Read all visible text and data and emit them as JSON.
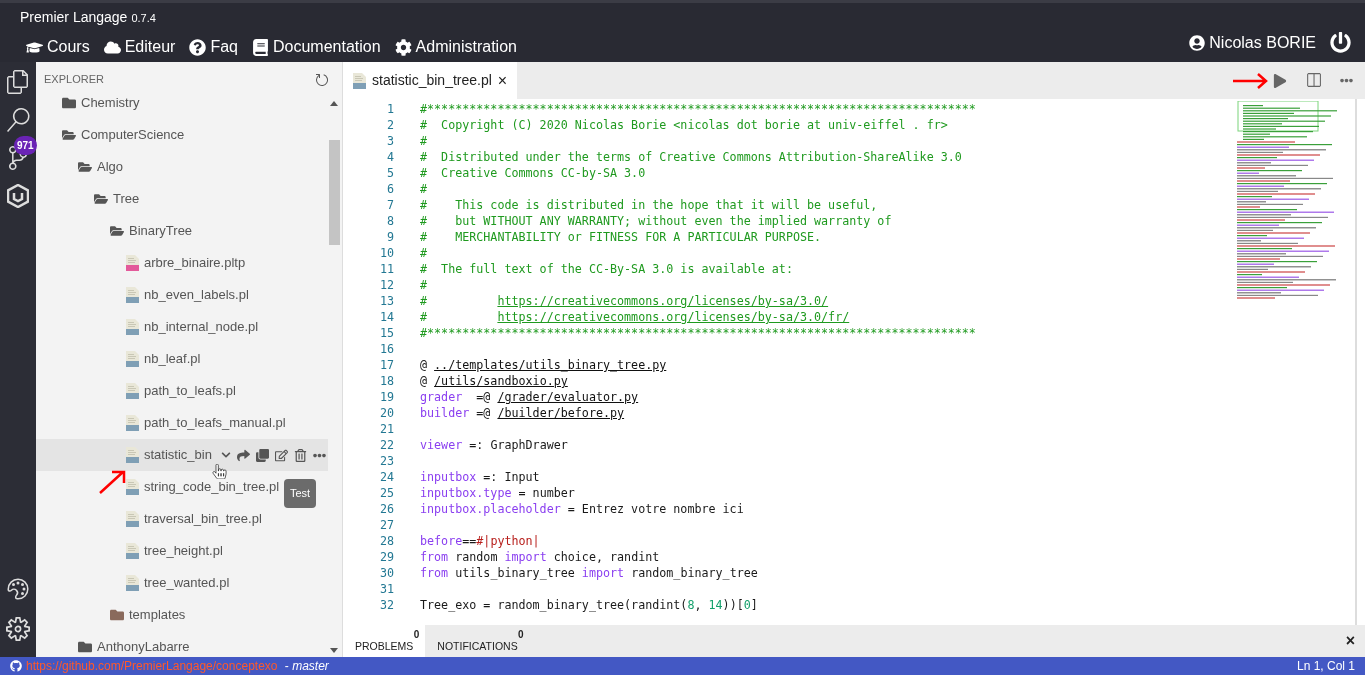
{
  "app": {
    "title": "Premier Langage",
    "version": "0.7.4"
  },
  "nav": [
    {
      "kind": "courses",
      "label": "Cours"
    },
    {
      "kind": "editor",
      "label": "Editeur"
    },
    {
      "kind": "faq",
      "label": "Faq"
    },
    {
      "kind": "docs",
      "label": "Documentation"
    },
    {
      "kind": "admin",
      "label": "Administration"
    }
  ],
  "user": {
    "name": "Nicolas BORIE"
  },
  "activity_bar": {
    "badge": "971"
  },
  "explorer": {
    "title": "EXPLORER",
    "tree": [
      {
        "kind": "folder",
        "label": "Chemistry",
        "expanded": false,
        "hovered": false
      },
      {
        "kind": "folder",
        "label": "ComputerScience",
        "expanded": true,
        "hovered": false,
        "children": [
          {
            "kind": "folder",
            "label": "Algo",
            "expanded": true,
            "hovered": false,
            "children": [
              {
                "kind": "folder",
                "label": "Tree",
                "expanded": true,
                "hovered": false,
                "children": [
                  {
                    "kind": "folder",
                    "label": "BinaryTree",
                    "expanded": true,
                    "hovered": false,
                    "children": [
                      {
                        "kind": "pltp",
                        "label": "arbre_binaire.pltp",
                        "hovered": false
                      },
                      {
                        "kind": "pl",
                        "label": "nb_even_labels.pl",
                        "hovered": false
                      },
                      {
                        "kind": "pl",
                        "label": "nb_internal_node.pl",
                        "hovered": false
                      },
                      {
                        "kind": "pl",
                        "label": "nb_leaf.pl",
                        "hovered": false
                      },
                      {
                        "kind": "pl",
                        "label": "path_to_leafs.pl",
                        "hovered": false
                      },
                      {
                        "kind": "pl",
                        "label": "path_to_leafs_manual.pl",
                        "hovered": false
                      },
                      {
                        "kind": "pl",
                        "label": "statistic_bin",
                        "hovered": true
                      },
                      {
                        "kind": "pl",
                        "label": "string_code_bin_tree.pl",
                        "hovered": false
                      },
                      {
                        "kind": "pl",
                        "label": "traversal_bin_tree.pl",
                        "hovered": false
                      },
                      {
                        "kind": "pl",
                        "label": "tree_height.pl",
                        "hovered": false
                      },
                      {
                        "kind": "pl",
                        "label": "tree_wanted.pl",
                        "hovered": false
                      }
                    ]
                  },
                  {
                    "kind": "template-folder",
                    "label": "templates",
                    "expanded": false,
                    "hovered": false
                  }
                ]
              }
            ]
          },
          {
            "kind": "folder",
            "label": "AnthonyLabarre",
            "expanded": false,
            "hovered": false
          }
        ]
      }
    ]
  },
  "tooltip": "Test",
  "editor": {
    "tabs": [
      {
        "label": "statistic_bin_tree.pl",
        "close": "×",
        "selected": true
      }
    ],
    "lines": [
      {
        "number": "1",
        "tokens": [
          {
            "kind": "comment",
            "text": "#******************************************************************************"
          }
        ]
      },
      {
        "number": "2",
        "tokens": [
          {
            "kind": "comment",
            "text": "#  Copyright (C) 2020 Nicolas Borie <nicolas dot borie at univ-eiffel . fr>"
          }
        ]
      },
      {
        "number": "3",
        "tokens": [
          {
            "kind": "comment",
            "text": "#"
          }
        ]
      },
      {
        "number": "4",
        "tokens": [
          {
            "kind": "comment",
            "text": "#  Distributed under the terms of Creative Commons Attribution-ShareAlike 3.0"
          }
        ]
      },
      {
        "number": "5",
        "tokens": [
          {
            "kind": "comment",
            "text": "#  Creative Commons CC-by-SA 3.0"
          }
        ]
      },
      {
        "number": "6",
        "tokens": [
          {
            "kind": "comment",
            "text": "#"
          }
        ]
      },
      {
        "number": "7",
        "tokens": [
          {
            "kind": "comment",
            "text": "#    This code is distributed in the hope that it will be useful,"
          }
        ]
      },
      {
        "number": "8",
        "tokens": [
          {
            "kind": "comment",
            "text": "#    but WITHOUT ANY WARRANTY; without even the implied warranty of"
          }
        ]
      },
      {
        "number": "9",
        "tokens": [
          {
            "kind": "comment",
            "text": "#    MERCHANTABILITY or FITNESS FOR A PARTICULAR PURPOSE."
          }
        ]
      },
      {
        "number": "10",
        "tokens": [
          {
            "kind": "comment",
            "text": "#"
          }
        ]
      },
      {
        "number": "11",
        "tokens": [
          {
            "kind": "comment",
            "text": "#  The full text of the CC-By-SA 3.0 is available at:"
          }
        ]
      },
      {
        "number": "12",
        "tokens": [
          {
            "kind": "comment",
            "text": "#"
          }
        ]
      },
      {
        "number": "13",
        "tokens": [
          {
            "kind": "comment",
            "text": "#          "
          },
          {
            "kind": "commentlink",
            "text": "https://creativecommons.org/licenses/by-sa/3.0/"
          }
        ]
      },
      {
        "number": "14",
        "tokens": [
          {
            "kind": "comment",
            "text": "#          "
          },
          {
            "kind": "commentlink",
            "text": "https://creativecommons.org/licenses/by-sa/3.0/fr/"
          }
        ]
      },
      {
        "number": "15",
        "tokens": [
          {
            "kind": "comment",
            "text": "#******************************************************************************"
          }
        ]
      },
      {
        "number": "16"
      },
      {
        "number": "17",
        "tokens": [
          {
            "kind": "plain",
            "text": "@ "
          },
          {
            "kind": "link",
            "text": "../templates/utils_binary_tree.py"
          }
        ]
      },
      {
        "number": "18",
        "tokens": [
          {
            "kind": "plain",
            "text": "@ "
          },
          {
            "kind": "link",
            "text": "/utils/sandboxio.py"
          }
        ]
      },
      {
        "number": "19",
        "tokens": [
          {
            "kind": "keyword",
            "text": "grader"
          },
          {
            "kind": "plain",
            "text": "  =@ "
          },
          {
            "kind": "link",
            "text": "/grader/evaluator.py"
          }
        ]
      },
      {
        "number": "20",
        "tokens": [
          {
            "kind": "keyword",
            "text": "builder"
          },
          {
            "kind": "plain",
            "text": " =@ "
          },
          {
            "kind": "link",
            "text": "/builder/before.py"
          }
        ]
      },
      {
        "number": "21"
      },
      {
        "number": "22",
        "tokens": [
          {
            "kind": "keyword",
            "text": "viewer"
          },
          {
            "kind": "plain",
            "text": " =: GraphDrawer"
          }
        ]
      },
      {
        "number": "23"
      },
      {
        "number": "24",
        "tokens": [
          {
            "kind": "keyword",
            "text": "inputbox"
          },
          {
            "kind": "plain",
            "text": " =: Input"
          }
        ]
      },
      {
        "number": "25",
        "tokens": [
          {
            "kind": "keyword",
            "text": "inputbox.type"
          },
          {
            "kind": "plain",
            "text": " = number"
          }
        ]
      },
      {
        "number": "26",
        "tokens": [
          {
            "kind": "keyword",
            "text": "inputbox.placeholder"
          },
          {
            "kind": "plain",
            "text": " = Entrez votre nombre ici"
          }
        ]
      },
      {
        "number": "27"
      },
      {
        "number": "28",
        "tokens": [
          {
            "kind": "keyword",
            "text": "before"
          },
          {
            "kind": "plain",
            "text": "=="
          },
          {
            "kind": "string",
            "text": "#|python|"
          }
        ]
      },
      {
        "number": "29",
        "tokens": [
          {
            "kind": "keyword",
            "text": "from"
          },
          {
            "kind": "plain",
            "text": " random "
          },
          {
            "kind": "keyword",
            "text": "import"
          },
          {
            "kind": "plain",
            "text": " choice, randint"
          }
        ]
      },
      {
        "number": "30",
        "tokens": [
          {
            "kind": "keyword",
            "text": "from"
          },
          {
            "kind": "plain",
            "text": " utils_binary_tree "
          },
          {
            "kind": "keyword",
            "text": "import"
          },
          {
            "kind": "plain",
            "text": " random_binary_tree"
          }
        ]
      },
      {
        "number": "31"
      },
      {
        "number": "32",
        "tokens": [
          {
            "kind": "plain",
            "text": "Tree_exo = random_binary_tree(randint("
          },
          {
            "kind": "number",
            "text": "8"
          },
          {
            "kind": "plain",
            "text": ", "
          },
          {
            "kind": "number",
            "text": "14"
          },
          {
            "kind": "plain",
            "text": "))["
          },
          {
            "kind": "number",
            "text": "0"
          },
          {
            "kind": "plain",
            "text": "]"
          }
        ]
      }
    ]
  },
  "panel": {
    "tabs": [
      {
        "label": "PROBLEMS",
        "count": "0",
        "selected": true
      },
      {
        "label": "NOTIFICATIONS",
        "count": "0",
        "selected": false
      }
    ],
    "close": "×"
  },
  "status_bar": {
    "repo": "https://github.com/PremierLangage/conceptexo",
    "separator": " - ",
    "branch": "master",
    "position": "Ln 1, Col 1"
  }
}
